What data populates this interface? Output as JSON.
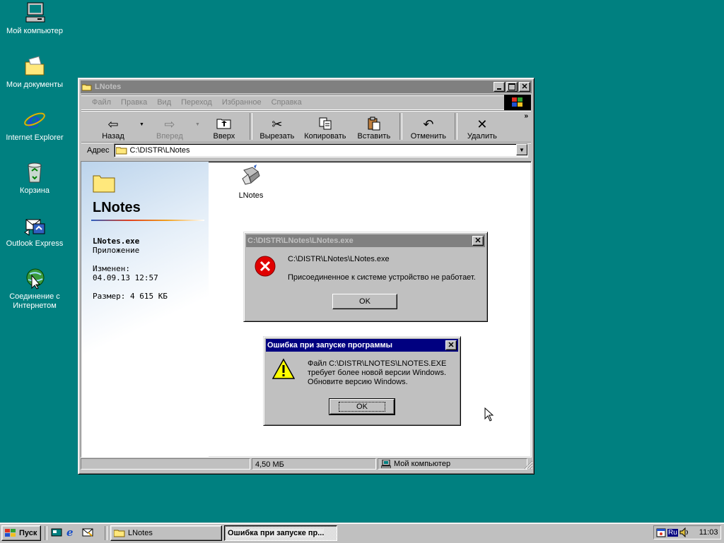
{
  "desktop": {
    "icons": [
      {
        "label": "Мой компьютер",
        "icon": "my-computer-icon"
      },
      {
        "label": "Мои документы",
        "icon": "my-documents-icon"
      },
      {
        "label": "Internet Explorer",
        "icon": "internet-explorer-icon"
      },
      {
        "label": "Корзина",
        "icon": "recycle-bin-icon"
      },
      {
        "label": "Outlook Express",
        "icon": "outlook-express-icon"
      },
      {
        "label1": "Соединение с",
        "label2": "Интернетом",
        "icon": "internet-connection-icon"
      }
    ]
  },
  "explorer": {
    "title": "LNotes",
    "menu": [
      "Файл",
      "Правка",
      "Вид",
      "Переход",
      "Избранное",
      "Справка"
    ],
    "toolbar": {
      "back": "Назад",
      "forward": "Вперед",
      "up": "Вверх",
      "cut": "Вырезать",
      "copy": "Копировать",
      "paste": "Вставить",
      "undo": "Отменить",
      "delete": "Удалить"
    },
    "address_label": "Адрес",
    "address_value": "C:\\DISTR\\LNotes",
    "panel": {
      "folder_name": "LNotes",
      "file_name": "LNotes.exe",
      "file_type": "Приложение",
      "modified_label": "Изменен:",
      "modified_value": "04.09.13 12:57",
      "size_text": "Размер: 4 615 КБ"
    },
    "file_icon_label": "LNotes",
    "status": {
      "size": "4,50 МБ",
      "location": "Мой компьютер"
    }
  },
  "dialog_error": {
    "title": "C:\\DISTR\\LNotes\\LNotes.exe",
    "line1": "C:\\DISTR\\LNotes\\LNotes.exe",
    "line2": "Присоединенное к системе устройство не работает.",
    "ok": "OK"
  },
  "dialog_warning": {
    "title": "Ошибка при запуске программы",
    "line1": "Файл C:\\DISTR\\LNOTES\\LNOTES.EXE",
    "line2": "требует более новой версии Windows.",
    "line3": "Обновите версию Windows.",
    "ok": "OK"
  },
  "taskbar": {
    "start": "Пуск",
    "tasks": [
      "LNotes",
      "Ошибка при запуске пр..."
    ],
    "lang": "Ru",
    "clock": "11:03"
  }
}
